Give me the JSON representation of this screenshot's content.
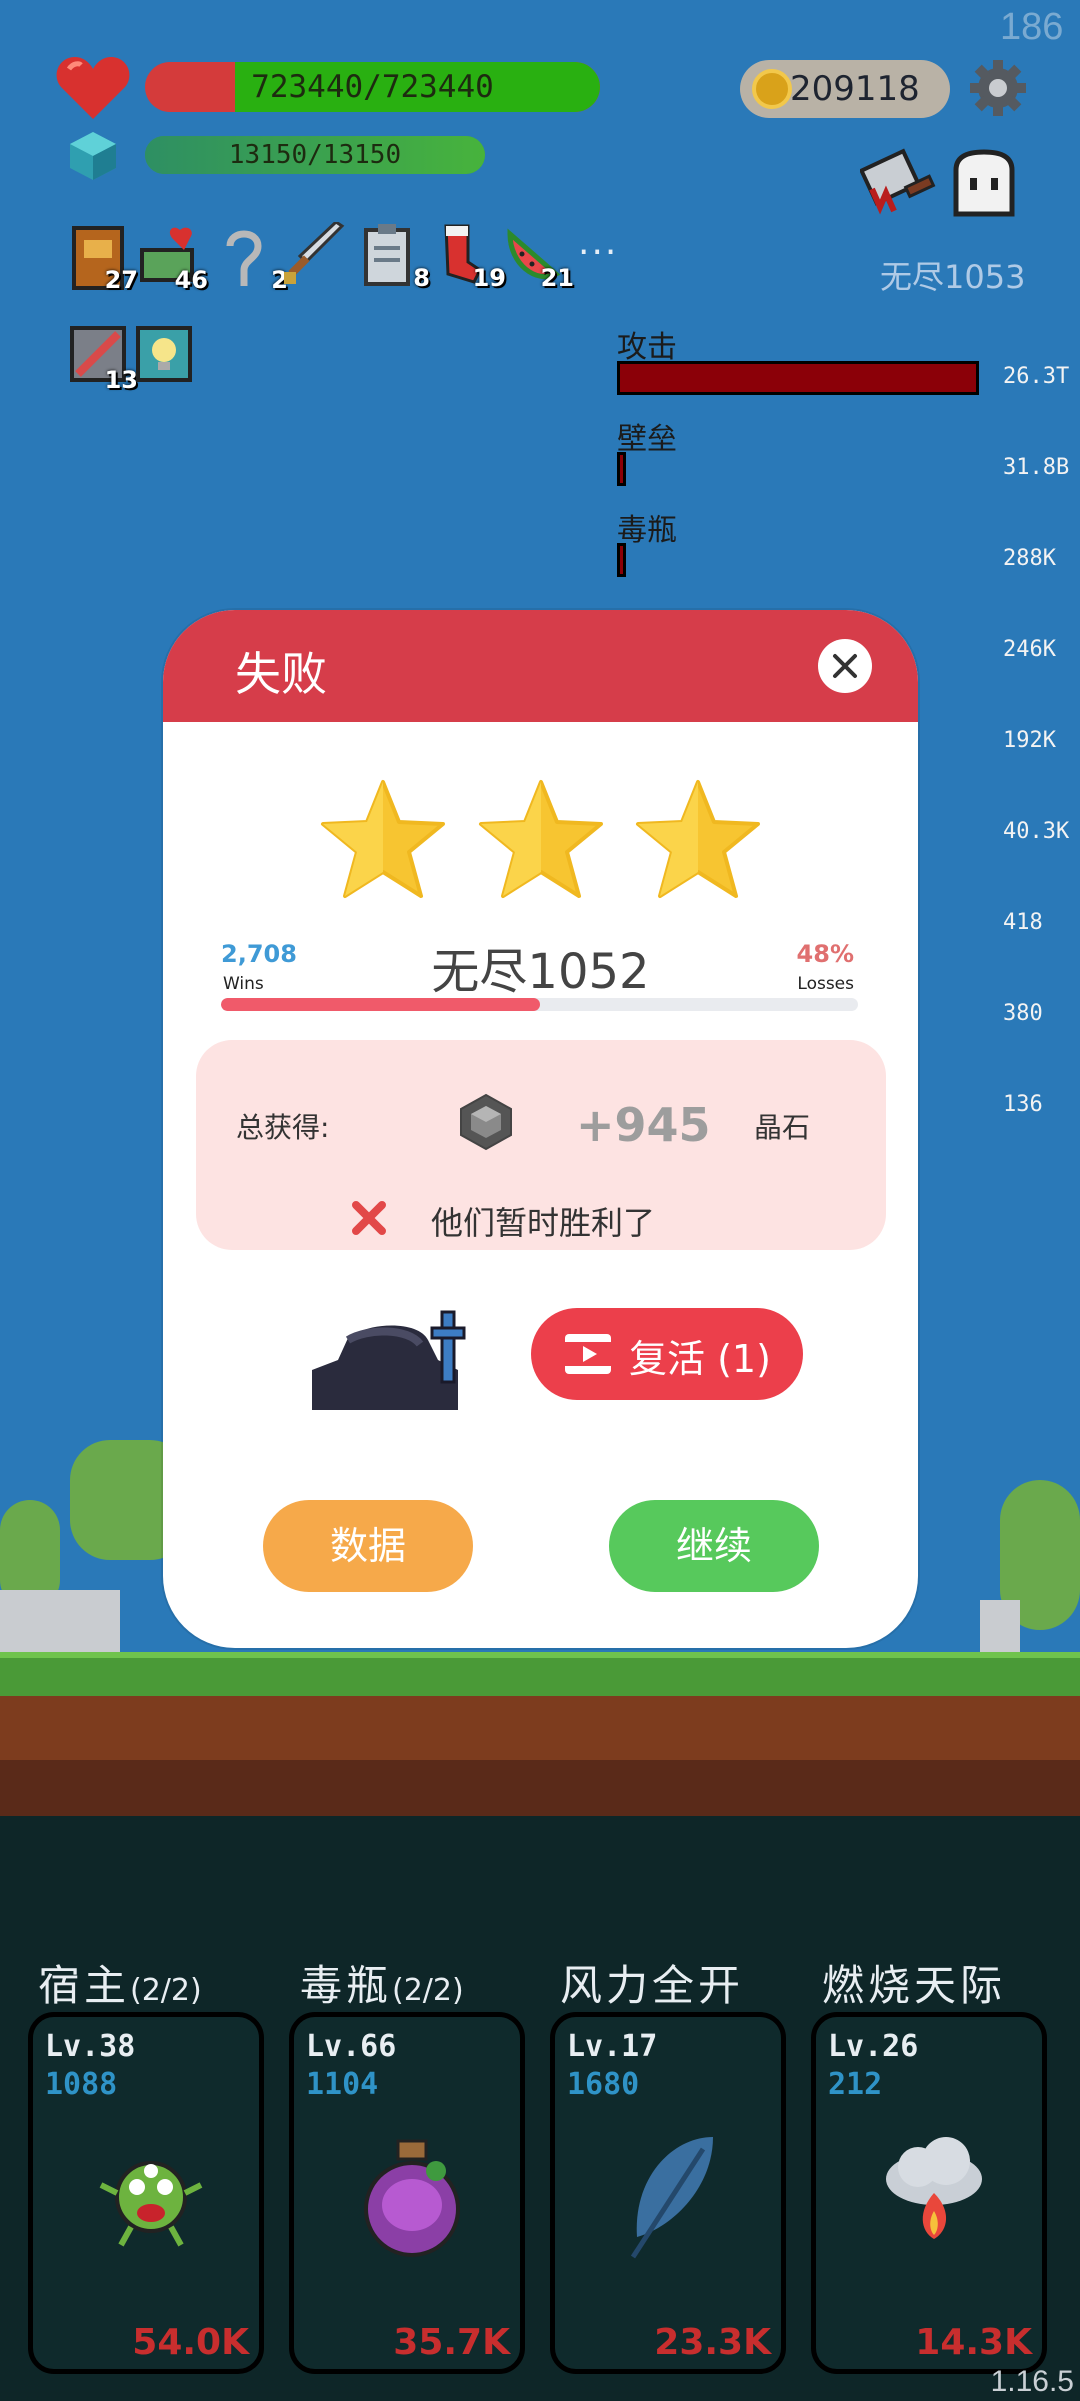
{
  "hud": {
    "fps": "186",
    "hp_text": "723440/723440",
    "hp_fraction": 1.0,
    "mana_text": "13150/13150",
    "mana_fraction": 1.0,
    "coins": "209118",
    "stage": "无尽1053"
  },
  "items": [
    {
      "icon": "book-icon",
      "count": "27"
    },
    {
      "icon": "heart-cash-icon",
      "count": "46"
    },
    {
      "icon": "hook-icon",
      "count": "2"
    },
    {
      "icon": "sword-icon",
      "count": ""
    },
    {
      "icon": "clipboard-icon",
      "count": "8"
    },
    {
      "icon": "sock-icon",
      "count": "19"
    },
    {
      "icon": "watermelon-icon",
      "count": "21"
    }
  ],
  "items_more": "···",
  "items_row2": [
    {
      "icon": "scroll-icon",
      "count": "13"
    },
    {
      "icon": "lightbulb-icon",
      "count": ""
    }
  ],
  "damage_stats": [
    {
      "label": "攻击",
      "value": "26.3T",
      "fraction": 1.0
    },
    {
      "label": "壁垒",
      "value": "31.8B",
      "fraction": 0.02
    },
    {
      "label": "毒瓶",
      "value": "288K",
      "fraction": 0.02
    },
    {
      "label": "",
      "value": "246K",
      "fraction": 0
    },
    {
      "label": "",
      "value": "192K",
      "fraction": 0
    },
    {
      "label": "",
      "value": "40.3K",
      "fraction": 0
    },
    {
      "label": "",
      "value": "418",
      "fraction": 0
    },
    {
      "label": "",
      "value": "380",
      "fraction": 0
    },
    {
      "label": "",
      "value": "136",
      "fraction": 0
    }
  ],
  "dialog": {
    "title": "失败",
    "stars": 3,
    "wins_value": "2,708",
    "wins_label": "Wins",
    "losses_value": "48%",
    "losses_label": "Losses",
    "stage_name": "无尽1052",
    "progress_fraction": 0.5,
    "reward_label": "总获得:",
    "reward_amount": "+945",
    "reward_unit": "晶石",
    "result_message": "他们暂时胜利了",
    "revive_label": "复活 (1)",
    "data_button": "数据",
    "continue_button": "继续"
  },
  "skills": [
    {
      "title": "宿主",
      "count": "(2/2)",
      "level": "Lv.38",
      "value": "1088",
      "damage": "54.0K",
      "icon": "virus-monster-icon"
    },
    {
      "title": "毒瓶",
      "count": "(2/2)",
      "level": "Lv.66",
      "value": "1104",
      "damage": "35.7K",
      "icon": "poison-bottle-icon"
    },
    {
      "title": "风力全开",
      "count": "",
      "level": "Lv.17",
      "value": "1680",
      "damage": "23.3K",
      "icon": "feather-icon"
    },
    {
      "title": "燃烧天际",
      "count": "",
      "level": "Lv.26",
      "value": "212",
      "damage": "14.3K",
      "icon": "fire-cloud-icon"
    }
  ],
  "version": "1.16.5",
  "colors": {
    "accent": "#d63d4a",
    "hp": "#29b011",
    "continue": "#57c95c",
    "data": "#f6a94a"
  }
}
